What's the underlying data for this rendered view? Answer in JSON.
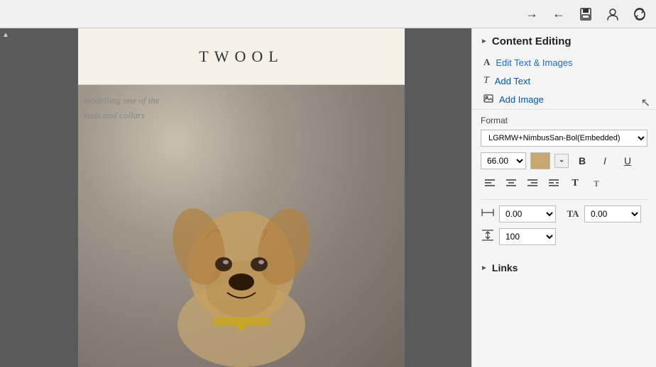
{
  "toolbar": {
    "icons": [
      "forward-icon",
      "back-icon",
      "save-icon",
      "profile-icon",
      "settings-icon"
    ]
  },
  "panel": {
    "content_editing_label": "Content Editing",
    "edit_text_images_label": "Edit Text & Images",
    "add_text_label": "Add Text",
    "add_image_label": "Add Image",
    "format_label": "Format",
    "font_value": "LGRMW+NimbusSan-Bol(Embedded)",
    "size_value": "66.00",
    "bold_label": "B",
    "italic_label": "I",
    "underline_label": "U",
    "align_left": "≡",
    "align_center": "≡",
    "align_right": "≡",
    "align_justify": "≡",
    "text_style1": "T",
    "text_style2": "T",
    "spacing_value1": "0.00",
    "spacing_value2": "0.00",
    "line_height_value": "100",
    "links_label": "Links"
  },
  "pdf": {
    "title": "TWOOL",
    "body_text_line1": "modelling one of the",
    "body_text_line2": "eads and collars"
  }
}
